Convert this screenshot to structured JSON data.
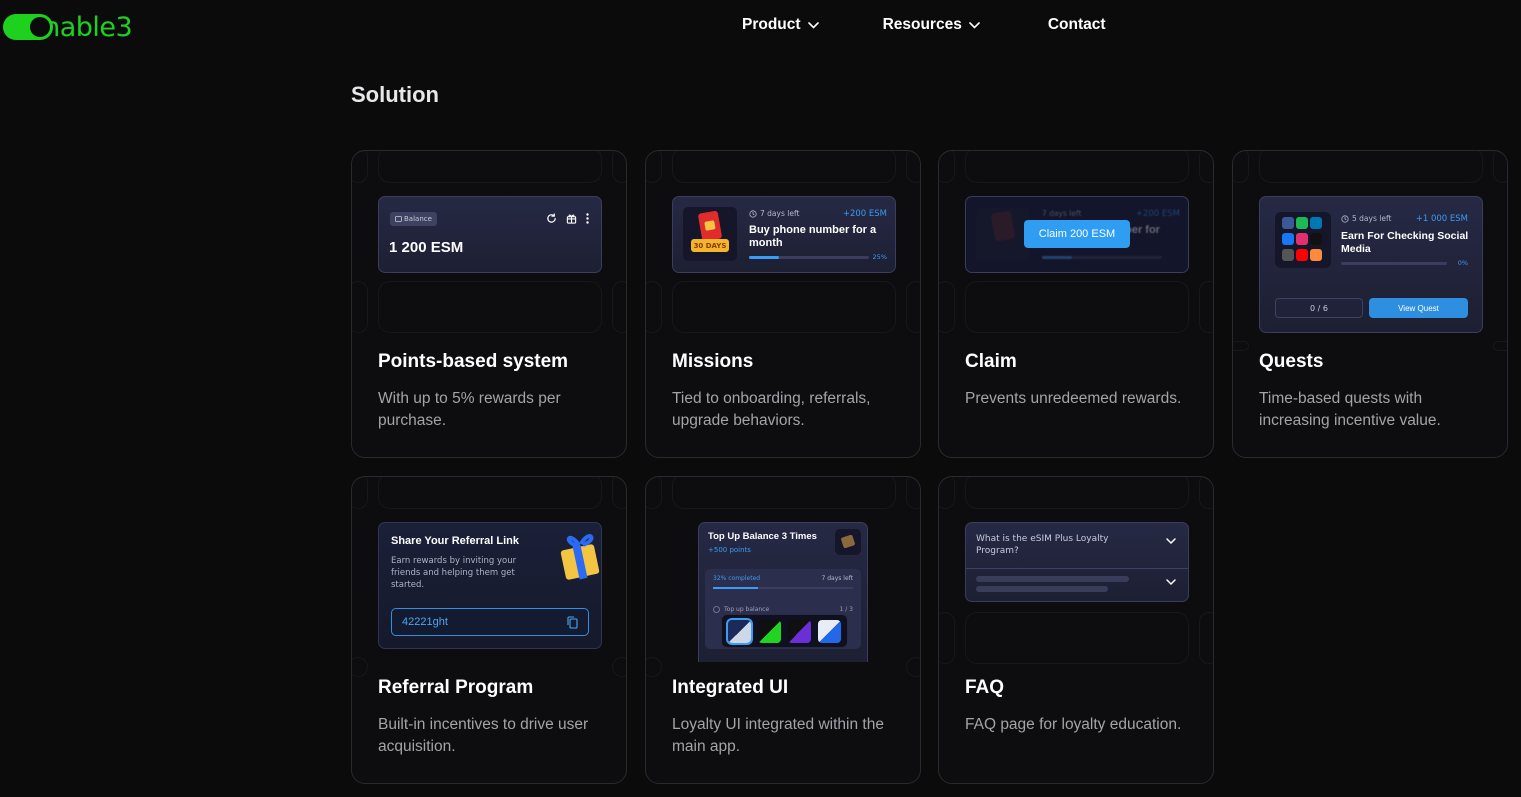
{
  "header": {
    "logo_text": "enable3",
    "nav": [
      {
        "label": "Product",
        "has_dropdown": true
      },
      {
        "label": "Resources",
        "has_dropdown": true
      },
      {
        "label": "Contact",
        "has_dropdown": false
      }
    ]
  },
  "section": {
    "title": "Solution"
  },
  "cards": {
    "points": {
      "title": "Points-based system",
      "desc": "With up to 5% rewards per purchase.",
      "balance_label": "Balance",
      "balance_value": "1 200 ESM"
    },
    "missions": {
      "title": "Missions",
      "desc": "Tied to onboarding, referrals, upgrade behaviors.",
      "days_left": "7 days left",
      "reward": "+200 ESM",
      "mission_title": "Buy phone number for a month",
      "progress": "25%",
      "progress_value": 0.25,
      "sim_tag": "30 DAYS"
    },
    "claim": {
      "title": "Claim",
      "desc": "Prevents unredeemed rewards.",
      "button": "Claim 200 ESM",
      "bg_days": "7 days left",
      "bg_reward": "+200 ESM",
      "bg_title": "Buy phone number for"
    },
    "quests": {
      "title": "Quests",
      "desc": "Time-based quests with increasing incentive value.",
      "days_left": "5 days left",
      "reward": "+1 000 ESM",
      "quest_title": "Earn For Checking Social Media",
      "progress": "0%",
      "progress_value": 0,
      "count": "0 / 6",
      "view_button": "View Quest"
    },
    "referral": {
      "title": "Referral Program",
      "desc": "Built-in incentives to drive user acquisition.",
      "mock_title": "Share Your Referral Link",
      "mock_desc": "Earn rewards by inviting your friends and helping them get started.",
      "code": "42221ght"
    },
    "integrated": {
      "title": "Integrated UI",
      "desc": "Loyalty UI integrated within the main app.",
      "mock_title": "Top Up Balance 3 Times",
      "mock_sub": "+500 points",
      "completed": "32% completed",
      "completed_value": 0.32,
      "days_left": "7 days left",
      "task": "Top up balance",
      "task_count": "1 / 3"
    },
    "faq": {
      "title": "FAQ",
      "desc": "FAQ page for loyalty education.",
      "question": "What is the eSIM Plus Loyalty Program?"
    }
  },
  "colors": {
    "brand_green": "#1fd11f",
    "accent_blue": "#2e9df2",
    "background": "#0b0b0c"
  }
}
